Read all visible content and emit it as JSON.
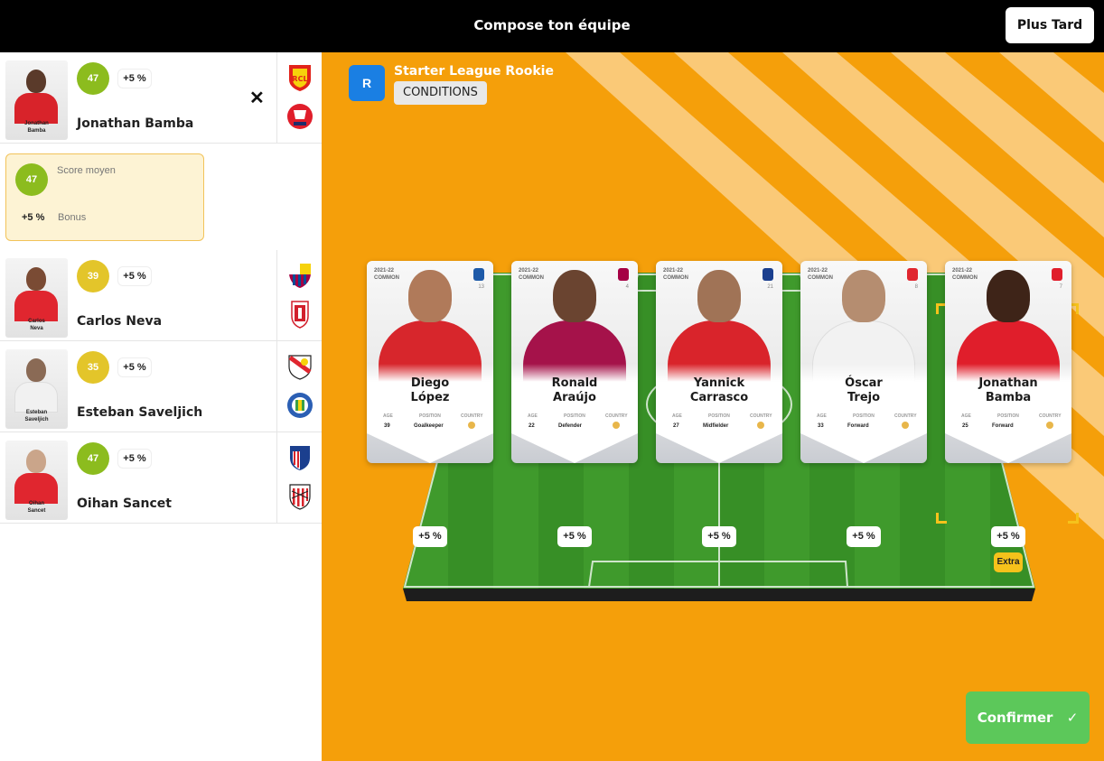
{
  "header": {
    "title": "Compose ton équipe",
    "later_label": "Plus Tard"
  },
  "selected_player": {
    "name": "Jonathan Bamba",
    "card_name": "Jonathan\nBamba",
    "score": "47",
    "bonus": "+5 %",
    "detail": {
      "score": "47",
      "score_label": "Score moyen",
      "bonus": "+5 %",
      "bonus_label": "Bonus"
    }
  },
  "player_list": [
    {
      "name": "Carlos Neva",
      "card_name": "Carlos\nNeva",
      "score": "39",
      "bonus": "+5 %"
    },
    {
      "name": "Esteban Saveljich",
      "card_name": "Esteban\nSaveljich",
      "score": "35",
      "bonus": "+5 %"
    },
    {
      "name": "Oihan Sancet",
      "card_name": "Oihan\nSancet",
      "score": "47",
      "bonus": "+5 %"
    }
  ],
  "league": {
    "badge": "R",
    "name": "Starter League Rookie",
    "conditions_label": "CONDITIONS"
  },
  "lineup": [
    {
      "season": "2021-22",
      "rarity": "COMMON",
      "number": "13",
      "name_line1": "Diego",
      "name_line2": "López",
      "age_label": "AGE",
      "age": "39",
      "position_label": "POSITION",
      "position": "Goalkeeper",
      "country_label": "COUNTRY",
      "bonus": "+5 %"
    },
    {
      "season": "2021-22",
      "rarity": "COMMON",
      "number": "4",
      "name_line1": "Ronald",
      "name_line2": "Araújo",
      "age_label": "AGE",
      "age": "22",
      "position_label": "POSITION",
      "position": "Defender",
      "country_label": "COUNTRY",
      "bonus": "+5 %"
    },
    {
      "season": "2021-22",
      "rarity": "COMMON",
      "number": "21",
      "name_line1": "Yannick",
      "name_line2": "Carrasco",
      "age_label": "AGE",
      "age": "27",
      "position_label": "POSITION",
      "position": "Midfielder",
      "country_label": "COUNTRY",
      "bonus": "+5 %"
    },
    {
      "season": "2021-22",
      "rarity": "COMMON",
      "number": "8",
      "name_line1": "Óscar",
      "name_line2": "Trejo",
      "age_label": "AGE",
      "age": "33",
      "position_label": "POSITION",
      "position": "Forward",
      "country_label": "COUNTRY",
      "bonus": "+5 %"
    },
    {
      "season": "2021-22",
      "rarity": "COMMON",
      "number": "7",
      "name_line1": "Jonathan",
      "name_line2": "Bamba",
      "age_label": "AGE",
      "age": "25",
      "position_label": "POSITION",
      "position": "Forward",
      "country_label": "COUNTRY",
      "bonus": "+5 %",
      "tag": "Extra"
    }
  ],
  "confirm": {
    "label": "Confirmer",
    "icon": "check-icon"
  },
  "colors": {
    "stage": "#f59f0a",
    "score_green": "#8cbc1e",
    "score_yellow": "#e3c52a",
    "confirm": "#5cc85a",
    "extra": "#f6c21b",
    "league_badge": "#1a7fe3"
  }
}
